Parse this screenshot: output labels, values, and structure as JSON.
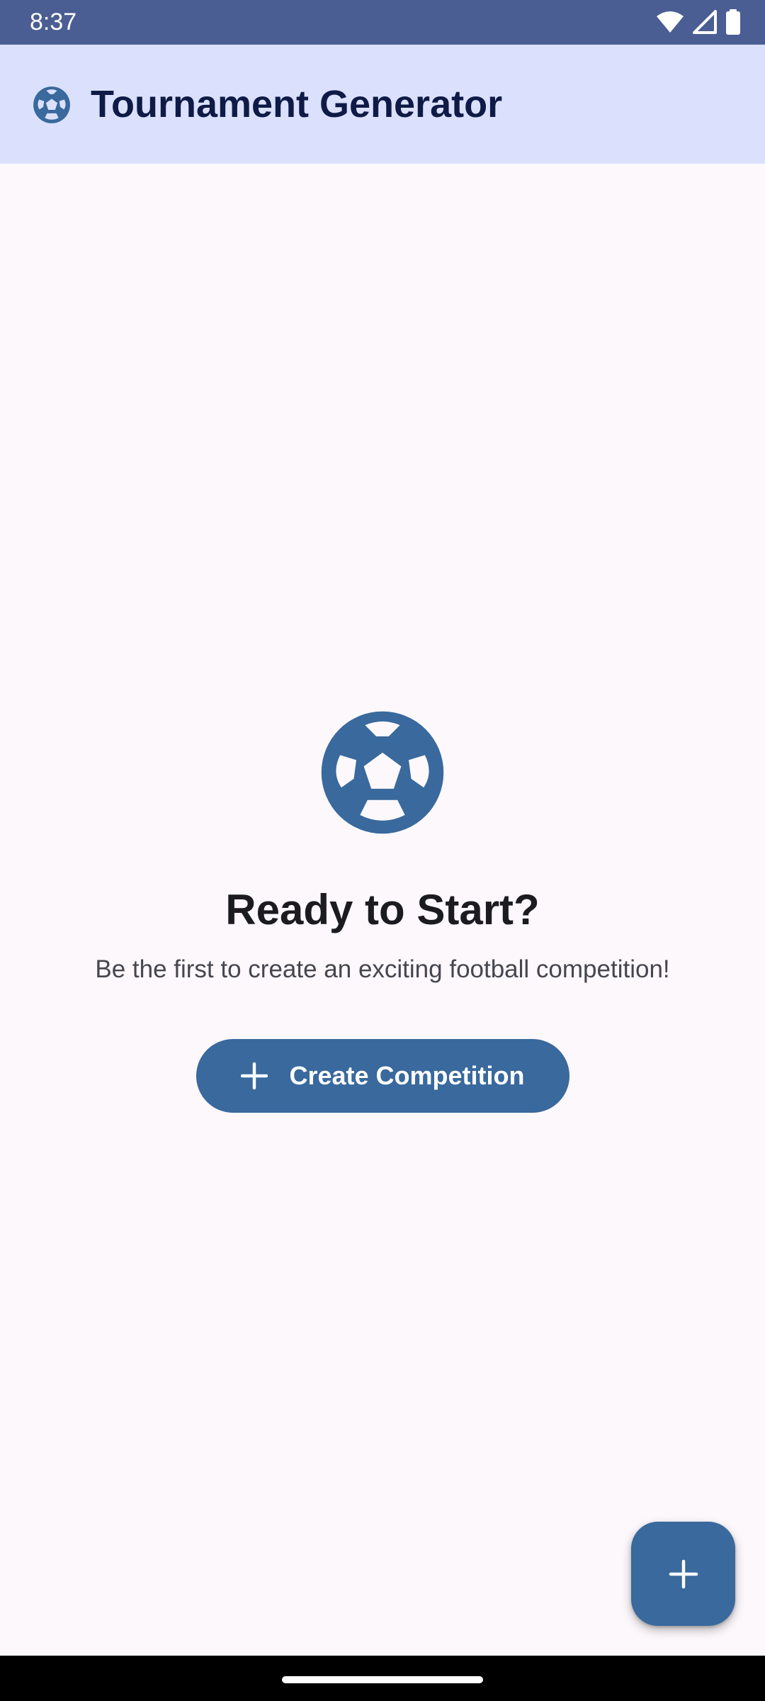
{
  "status_bar": {
    "time": "8:37",
    "icons": [
      "wifi-icon",
      "cellular-signal-icon",
      "battery-icon"
    ]
  },
  "app_bar": {
    "title": "Tournament Generator",
    "icon": "soccer-ball-icon"
  },
  "empty_state": {
    "icon": "soccer-ball-icon",
    "title": "Ready to Start?",
    "subtitle": "Be the first to create an exciting football competition!",
    "create_button_label": "Create Competition",
    "create_button_icon": "plus-icon"
  },
  "fab": {
    "icon": "plus-icon"
  },
  "colors": {
    "status_bar": "#4b5e93",
    "app_bar": "#dbe1fd",
    "primary": "#39699d",
    "background": "#fcf8fc",
    "title_text": "#0f1b46"
  }
}
